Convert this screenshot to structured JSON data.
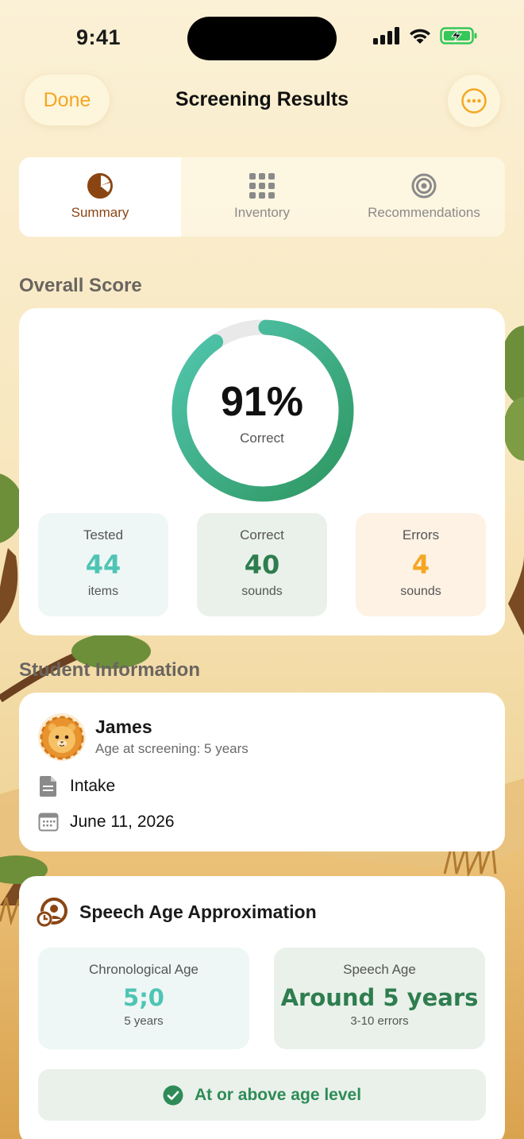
{
  "status_bar": {
    "time": "9:41"
  },
  "nav": {
    "done_label": "Done",
    "title": "Screening Results"
  },
  "tabs": [
    {
      "label": "Summary",
      "icon": "pie-chart-icon",
      "active": true
    },
    {
      "label": "Inventory",
      "icon": "grid-icon",
      "active": false
    },
    {
      "label": "Recommendations",
      "icon": "target-icon",
      "active": false
    }
  ],
  "overall": {
    "section_label": "Overall Score",
    "percent": 91,
    "percent_label": "91%",
    "percent_sub": "Correct",
    "stats": {
      "tested": {
        "label": "Tested",
        "value": "44",
        "unit": "items"
      },
      "correct": {
        "label": "Correct",
        "value": "40",
        "unit": "sounds"
      },
      "errors": {
        "label": "Errors",
        "value": "4",
        "unit": "sounds"
      }
    }
  },
  "student": {
    "section_label": "Student Information",
    "name": "James",
    "age": "Age at screening: 5 years",
    "type": "Intake",
    "date": "June 11, 2026"
  },
  "speech_age": {
    "title": "Speech Age Approximation",
    "chronological": {
      "label": "Chronological Age",
      "value": "5;0",
      "sub": "5 years"
    },
    "speech": {
      "label": "Speech Age",
      "value": "Around 5 years",
      "sub": "3-10 errors"
    },
    "level": "At or above age level"
  },
  "colors": {
    "accent": "#f5a623",
    "brown": "#8b4513",
    "teal": "#4fc4b4",
    "green": "#2e7d4f"
  }
}
